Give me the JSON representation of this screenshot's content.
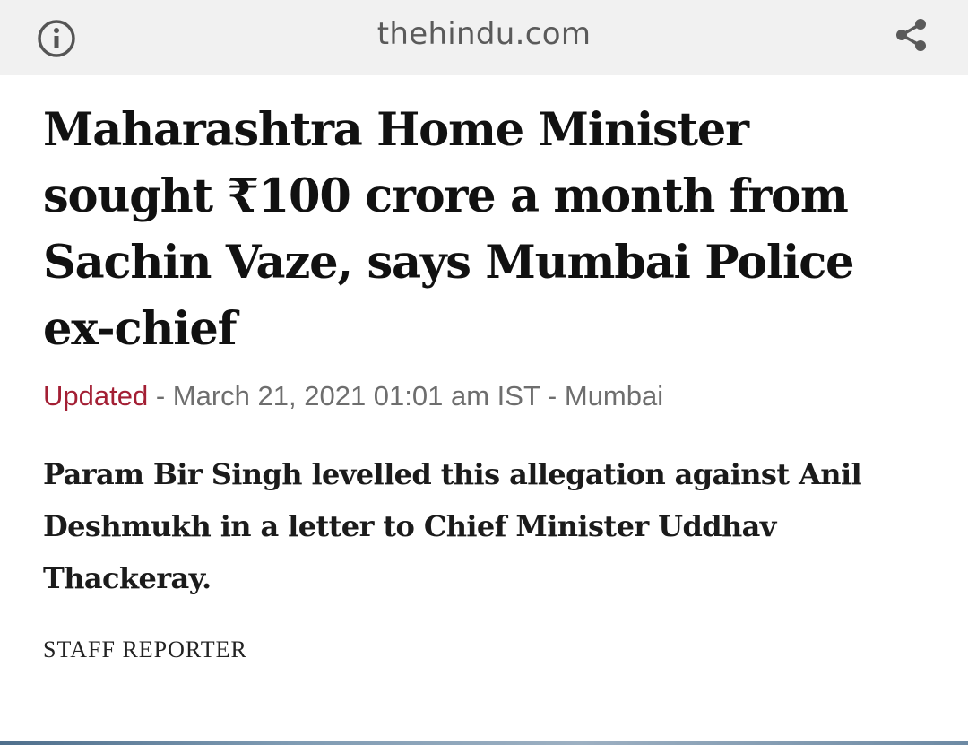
{
  "browser": {
    "domain": "thehindu.com",
    "info_icon": "info-icon",
    "share_icon": "share-icon"
  },
  "article": {
    "headline": "Maharashtra Home Minister sought ₹100 crore a month from Sachin Vaze, says Mumbai Police ex-chief",
    "updated_label": "Updated",
    "meta_rest": " - March 21, 2021 01:01 am IST - Mumbai",
    "summary": "Param Bir Singh levelled this allegation against Anil Deshmukh in a letter to Chief Minister Uddhav Thackeray.",
    "byline": "STAFF REPORTER"
  },
  "colors": {
    "topbar_bg": "#f1f1f1",
    "accent_red": "#a31f34",
    "meta_gray": "#6e6e6e",
    "headline_text": "#111111"
  }
}
